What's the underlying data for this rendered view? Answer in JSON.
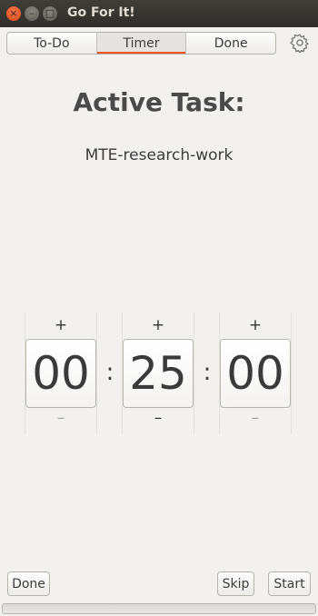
{
  "window": {
    "title": "Go For It!",
    "buttons": {
      "close": "×",
      "minimize": "–",
      "maximize": "□"
    }
  },
  "tabs": [
    {
      "label": "To-Do",
      "active": false
    },
    {
      "label": "Timer",
      "active": true
    },
    {
      "label": "Done",
      "active": false
    }
  ],
  "settings_icon": "gear-icon",
  "heading": "Active Task:",
  "task_name": "MTE-research-work",
  "timer": {
    "increment_symbol": "+",
    "decrement_symbol": "–",
    "separator": ":",
    "hours": "00",
    "minutes": "25",
    "seconds": "00"
  },
  "actions": {
    "done": "Done",
    "skip": "Skip",
    "start": "Start"
  },
  "progress": {
    "value": 0
  },
  "colors": {
    "accent": "#e95420",
    "titlebar": "#3a3935",
    "background": "#f2f1f0"
  }
}
